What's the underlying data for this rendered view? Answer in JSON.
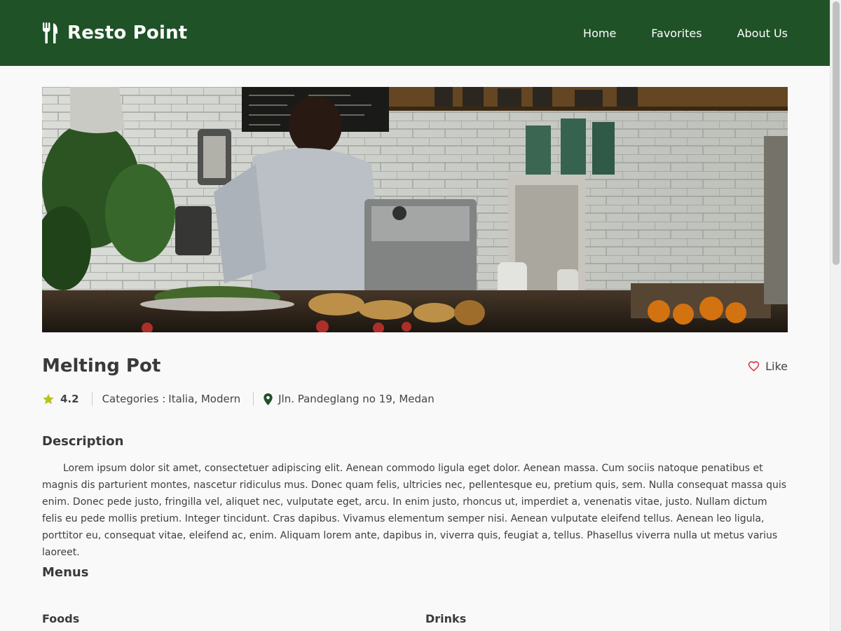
{
  "header": {
    "brand_icon": "utensils-icon",
    "title": "Resto Point",
    "nav": [
      {
        "label": "Home"
      },
      {
        "label": "Favorites"
      },
      {
        "label": "About Us"
      }
    ]
  },
  "restaurant": {
    "hero_image": "restaurant-kitchen-photo",
    "name": "Melting Pot",
    "like_label": "Like",
    "like_icon": "heart-icon",
    "rating": "4.2",
    "rating_icon": "star-icon",
    "categories_label": "Categories :",
    "categories": "Italia, Modern",
    "address_icon": "map-pin-icon",
    "address": "Jln. Pandeglang no 19, Medan"
  },
  "description": {
    "heading": "Description",
    "text": "Lorem ipsum dolor sit amet, consectetuer adipiscing elit. Aenean commodo ligula eget dolor. Aenean massa. Cum sociis natoque penatibus et magnis dis parturient montes, nascetur ridiculus mus. Donec quam felis, ultricies nec, pellentesque eu, pretium quis, sem. Nulla consequat massa quis enim. Donec pede justo, fringilla vel, aliquet nec, vulputate eget, arcu. In enim justo, rhoncus ut, imperdiet a, venenatis vitae, justo. Nullam dictum felis eu pede mollis pretium. Integer tincidunt. Cras dapibus. Vivamus elementum semper nisi. Aenean vulputate eleifend tellus. Aenean leo ligula, porttitor eu, consequat vitae, eleifend ac, enim. Aliquam lorem ante, dapibus in, viverra quis, feugiat a, tellus. Phasellus viverra nulla ut metus varius laoreet."
  },
  "menus": {
    "heading": "Menus",
    "foods_heading": "Foods",
    "drinks_heading": "Drinks"
  },
  "colors": {
    "header_bg": "#1f5227",
    "star": "#b8c21a",
    "heart": "#d6334a",
    "pin": "#1f5227"
  }
}
